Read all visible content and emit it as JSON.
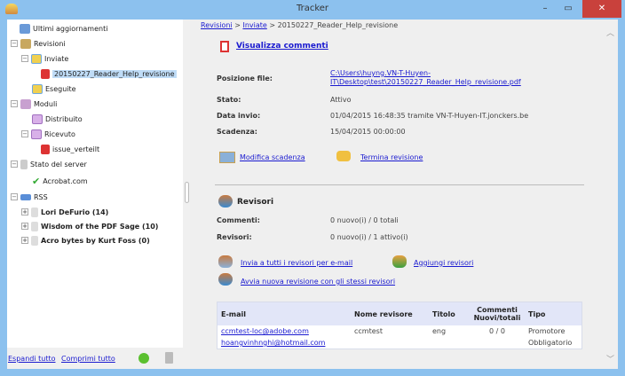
{
  "window": {
    "title": "Tracker",
    "minimize": "–",
    "maximize": "▭",
    "close": "✕"
  },
  "tree": {
    "latest": "Ultimi aggiornamenti",
    "reviews": "Revisioni",
    "sent": "Inviate",
    "selected_doc": "20150227_Reader_Help_revisione",
    "done": "Eseguite",
    "forms": "Moduli",
    "distributed": "Distribuito",
    "received": "Ricevuto",
    "issue": "issue_verteilt",
    "server": "Stato del server",
    "acrobat": "Acrobat.com",
    "rss": "RSS",
    "feeds": [
      "Lori DeFurio (14)",
      "Wisdom of the PDF Sage (10)",
      "Acro bytes by Kurt Foss (0)"
    ]
  },
  "footer": {
    "expand": "Espandi tutto",
    "collapse": "Comprimi tutto"
  },
  "breadcrumb": {
    "part1": "Revisioni",
    "sep": ">",
    "part2": "Inviate",
    "current": "20150227_Reader_Help_revisione"
  },
  "details": {
    "view_comments": "Visualizza commenti",
    "file_label": "Posizione file:",
    "file_line1": "C:\\Users\\huyng.VN-T-Huyen-",
    "file_line2": "IT\\Desktop\\test\\20150227_Reader_Help_revisione.pdf",
    "status_label": "Stato:",
    "status": "Attivo",
    "sent_label": "Data invio:",
    "sent": "01/04/2015 16:48:35 tramite VN-T-Huyen-IT.jonckers.be",
    "deadline_label": "Scadenza:",
    "deadline": "15/04/2015 00:00:00",
    "change_deadline": "Modifica scadenza",
    "end_review": "Termina revisione"
  },
  "reviewers": {
    "title": "Revisori",
    "comments_label": "Commenti:",
    "comments": "0 nuovo(i) / 0 totali",
    "reviewers_label": "Revisori:",
    "reviewers": "0 nuovo(i) / 1 attivo(i)",
    "email_all": "Invia a tutti i revisori per e-mail",
    "add": "Aggiungi revisori",
    "restart": "Avvia nuova revisione con gli stessi revisori",
    "headers": [
      "E-mail",
      "Nome revisore",
      "Titolo",
      "Commenti Nuovi/totali",
      "Tipo"
    ],
    "rows": [
      [
        "ccmtest-loc@adobe.com",
        "ccmtest",
        "eng",
        "0 / 0",
        "Promotore"
      ],
      [
        "hoangvinhnghi@hotmail.com",
        "",
        "",
        "",
        "Obbligatorio"
      ]
    ]
  }
}
